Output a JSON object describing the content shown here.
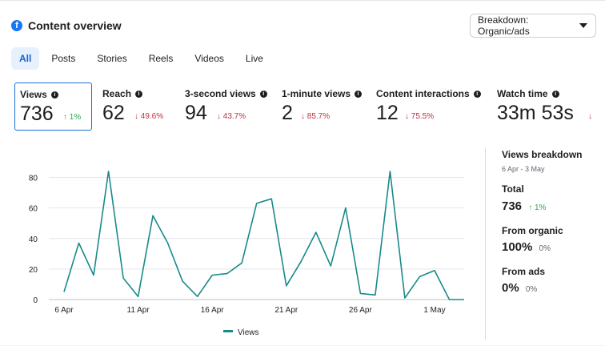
{
  "header": {
    "title": "Content overview",
    "icon": "facebook-icon",
    "breakdown_label": "Breakdown: Organic/ads"
  },
  "tabs": [
    "All",
    "Posts",
    "Stories",
    "Reels",
    "Videos",
    "Live"
  ],
  "metrics": [
    {
      "label": "Views",
      "value": "736",
      "delta": "↑ 1%",
      "direction": "up"
    },
    {
      "label": "Reach",
      "value": "62",
      "delta": "↓ 49.6%",
      "direction": "down"
    },
    {
      "label": "3-second views",
      "value": "94",
      "delta": "↓ 43.7%",
      "direction": "down"
    },
    {
      "label": "1-minute views",
      "value": "2",
      "delta": "↓ 85.7%",
      "direction": "down"
    },
    {
      "label": "Content interactions",
      "value": "12",
      "delta": "↓ 75.5%",
      "direction": "down"
    },
    {
      "label": "Watch time",
      "value": "33m 53s",
      "delta": "↓",
      "direction": "down"
    }
  ],
  "breakdown_panel": {
    "title": "Views breakdown",
    "range": "6 Apr - 3 May",
    "total_label": "Total",
    "total_value": "736",
    "total_delta": "↑ 1%",
    "organic_label": "From organic",
    "organic_value": "100%",
    "organic_sub": "0%",
    "ads_label": "From ads",
    "ads_value": "0%",
    "ads_sub": "0%"
  },
  "colors": {
    "accent": "#1877f2",
    "line": "#1a8a8a",
    "up": "#31a24c",
    "down": "#c3303b"
  },
  "chart_data": {
    "type": "line",
    "x": [
      "6 Apr",
      "7 Apr",
      "8 Apr",
      "9 Apr",
      "10 Apr",
      "11 Apr",
      "12 Apr",
      "13 Apr",
      "14 Apr",
      "15 Apr",
      "16 Apr",
      "17 Apr",
      "18 Apr",
      "19 Apr",
      "20 Apr",
      "21 Apr",
      "22 Apr",
      "23 Apr",
      "24 Apr",
      "25 Apr",
      "26 Apr",
      "27 Apr",
      "28 Apr",
      "29 Apr",
      "30 Apr",
      "1 May",
      "2 May",
      "3 May"
    ],
    "series": [
      {
        "name": "Views",
        "values": [
          5,
          37,
          16,
          84,
          14,
          2,
          55,
          37,
          12,
          2,
          16,
          17,
          24,
          63,
          66,
          9,
          25,
          44,
          22,
          60,
          4,
          3,
          84,
          1,
          15,
          19,
          0,
          0
        ]
      }
    ],
    "x_tick_labels": [
      "6 Apr",
      "11 Apr",
      "16 Apr",
      "21 Apr",
      "26 Apr",
      "1 May"
    ],
    "y_ticks": [
      0,
      20,
      40,
      60,
      80
    ],
    "ylim": [
      0,
      88
    ],
    "grid": true,
    "legend": "bottom"
  }
}
